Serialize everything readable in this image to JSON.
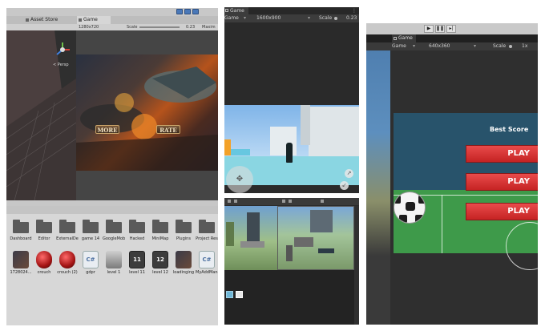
{
  "panel1": {
    "tabs": [
      "Asset Store",
      "Game"
    ],
    "toolbar": {
      "resolution": "1280x720",
      "scale_label": "Scale",
      "scale_value": "0.23",
      "maximize": "Maxim"
    },
    "persp_label": "< Persp",
    "game_buttons": [
      "MORE",
      "RATE"
    ],
    "folders": [
      "Dashboard",
      "Editor",
      "ExternalDe",
      "game 14",
      "GoogleMobi",
      "Hacked",
      "MiniMap",
      "Plugins",
      "Project Res"
    ],
    "assets": [
      {
        "label": "1728024...",
        "icon": "image-thumbnail"
      },
      {
        "label": "crouch",
        "icon": "sphere-red"
      },
      {
        "label": "crouch (2)",
        "icon": "sphere-red"
      },
      {
        "label": "gdpr",
        "icon": "csharp-script",
        "text": "C#"
      },
      {
        "label": "level 1",
        "icon": "shield-icon"
      },
      {
        "label": "level 11",
        "icon": "level-badge",
        "text": "11"
      },
      {
        "label": "level 12",
        "icon": "level-badge",
        "text": "12"
      },
      {
        "label": "loadinging",
        "icon": "image-thumbnail"
      },
      {
        "label": "MyAddMan...",
        "icon": "csharp-script",
        "text": "C#"
      }
    ]
  },
  "panel2": {
    "tab": "Game",
    "display_mode": "Game",
    "resolution": "1600x900",
    "scale_label": "Scale",
    "scale_value": "0.23"
  },
  "panel3": {
    "tab": "Game",
    "display_mode": "Game",
    "resolution": "640x360",
    "scale_label": "Scale",
    "scale_value": "1x",
    "best_score": "Best Score",
    "play_buttons": [
      "PLAY",
      "PLAY",
      "PLAY"
    ],
    "controls": [
      "play-icon",
      "pause-icon",
      "step-icon"
    ]
  },
  "colors": {
    "unity_dark": "#3c3c3c",
    "play_red": "#d83232",
    "field_green": "#3e9a4a",
    "game_bg": "#28536b"
  }
}
